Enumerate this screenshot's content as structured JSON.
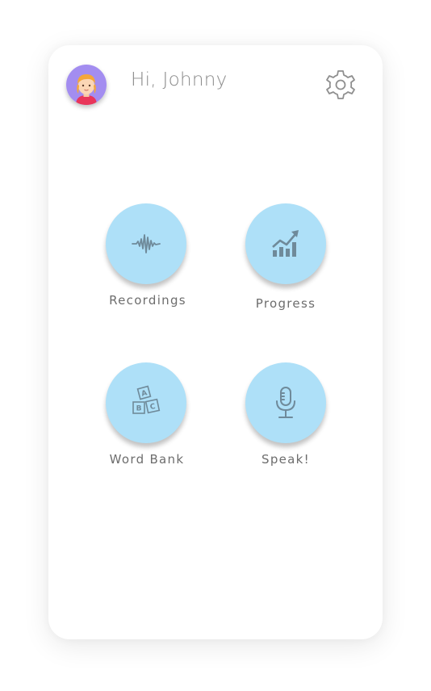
{
  "header": {
    "greeting": "Hi, Johnny",
    "avatar_icon": "child-avatar-icon",
    "settings_icon": "gear-icon"
  },
  "menu": {
    "items": [
      {
        "label": "Recordings",
        "icon": "waveform-icon"
      },
      {
        "label": "Progress",
        "icon": "chart-growth-icon"
      },
      {
        "label": "Word Bank",
        "icon": "abc-blocks-icon"
      },
      {
        "label": "Speak!",
        "icon": "microphone-icon"
      }
    ]
  },
  "colors": {
    "tile": "#aee0f8",
    "icon": "#6f8a9a",
    "avatar_bg": "#a38df0",
    "text": "#8b8b8b"
  }
}
